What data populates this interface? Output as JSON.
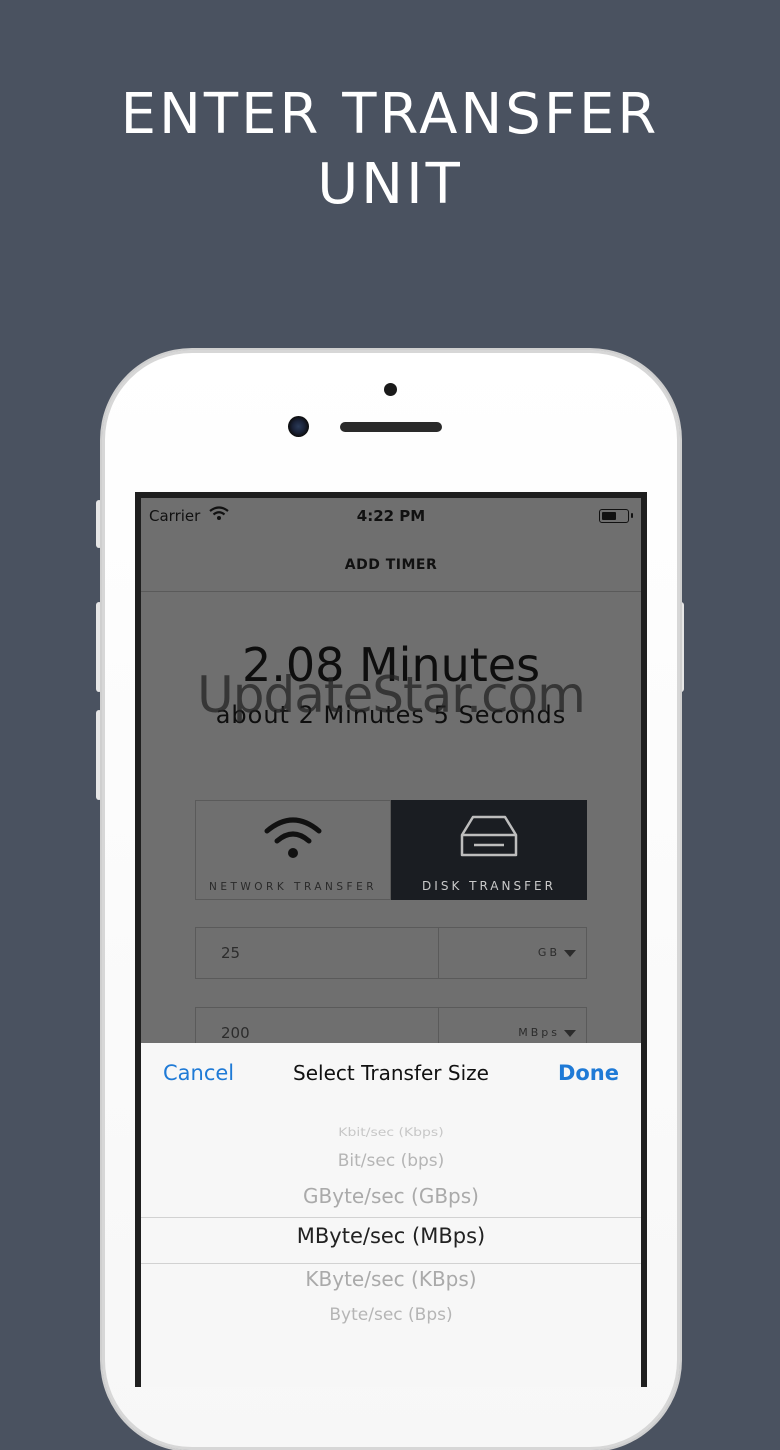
{
  "headline": {
    "line1": "ENTER TRANSFER",
    "line2": "UNIT"
  },
  "status_bar": {
    "carrier": "Carrier",
    "time": "4:22 PM"
  },
  "nav": {
    "title": "ADD TIMER"
  },
  "result": {
    "primary": "2.08 Minutes",
    "secondary": "about 2 Minutes 5 Seconds"
  },
  "watermark": "UpdateStar.com",
  "modes": [
    {
      "label": "NETWORK TRANSFER",
      "icon": "wifi-icon",
      "active": false
    },
    {
      "label": "DISK TRANSFER",
      "icon": "disk-icon",
      "active": true
    }
  ],
  "fields": {
    "size": {
      "value": "25",
      "unit": "GB"
    },
    "speed": {
      "value": "200",
      "unit": "MBps"
    }
  },
  "picker": {
    "cancel_label": "Cancel",
    "title": "Select Transfer Size",
    "done_label": "Done",
    "options": [
      "Kbit/sec (Kbps)",
      "Bit/sec (bps)",
      "GByte/sec (GBps)",
      "MByte/sec (MBps)",
      "KByte/sec (KBps)",
      "Byte/sec (Bps)"
    ],
    "selected": "MByte/sec (MBps)"
  },
  "colors": {
    "background": "#4a5260",
    "accent": "#1f7ad6",
    "active_segment": "#1a1d22"
  }
}
